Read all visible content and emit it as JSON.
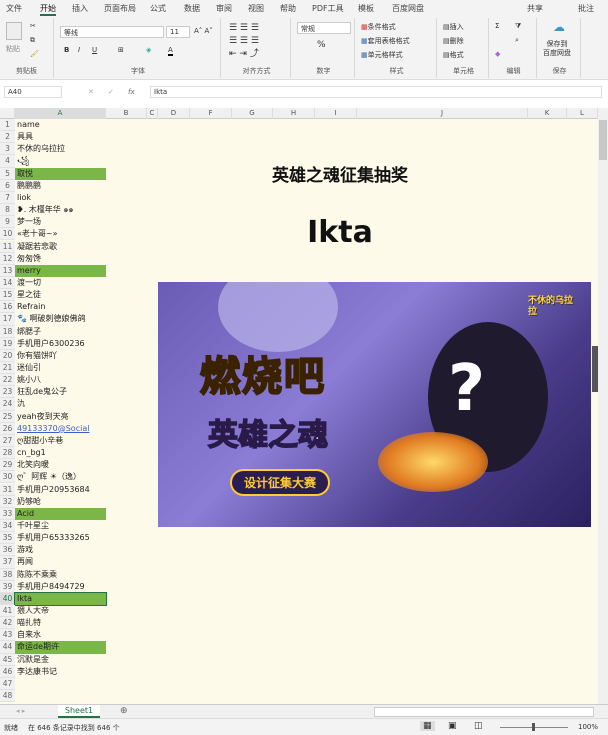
{
  "tabs": [
    "文件",
    "开始",
    "插入",
    "页面布局",
    "公式",
    "数据",
    "审阅",
    "视图",
    "帮助",
    "PDF工具",
    "模板",
    "百度网盘"
  ],
  "active_tab": "开始",
  "share": "共享",
  "comments": "批注",
  "ribbon": {
    "clipboard": {
      "paste": "粘贴",
      "label": "剪贴板"
    },
    "font": {
      "name": "等线",
      "size": "11",
      "label": "字体",
      "bold": "B",
      "italic": "I",
      "underline": "U"
    },
    "align": {
      "label": "对齐方式"
    },
    "number": {
      "format": "常规",
      "percent": "%",
      "label": "数字"
    },
    "styles": {
      "cond": "条件格式",
      "table": "套用表格格式",
      "cell": "单元格样式",
      "label": "样式"
    },
    "cells": {
      "insert": "插入",
      "delete": "删除",
      "format": "格式",
      "label": "单元格"
    },
    "edit": {
      "label": "编辑",
      "sum": "Σ"
    },
    "save": {
      "btn": "保存到\n百度网盘",
      "label": "保存"
    }
  },
  "formula_bar": {
    "name_box": "A40",
    "fx": "fx",
    "value": "Ikta"
  },
  "columns": [
    "A",
    "B",
    "C",
    "D",
    "F",
    "G",
    "H",
    "I",
    "J",
    "K",
    "L"
  ],
  "rows": [
    {
      "n": 1,
      "v": "name"
    },
    {
      "n": 2,
      "v": "具具"
    },
    {
      "n": 3,
      "v": "不休的乌拉拉"
    },
    {
      "n": 4,
      "v": "꧁"
    },
    {
      "n": 5,
      "v": "取悦",
      "hl": true
    },
    {
      "n": 6,
      "v": "鹏鹏鹏"
    },
    {
      "n": 7,
      "v": "liok"
    },
    {
      "n": 8,
      "v": "❥. 木槿年华 ๑๑"
    },
    {
      "n": 9,
      "v": "梦一场"
    },
    {
      "n": 10,
      "v": "«老十哥~»"
    },
    {
      "n": 11,
      "v": "凝踞若悲歌"
    },
    {
      "n": 12,
      "v": "匆匆馋"
    },
    {
      "n": 13,
      "v": "merry",
      "hl": true
    },
    {
      "n": 14,
      "v": "渡一切"
    },
    {
      "n": 15,
      "v": "星之徒"
    },
    {
      "n": 16,
      "v": "Refrain"
    },
    {
      "n": 17,
      "v": "🐾 啊破刺德娘佛鸽"
    },
    {
      "n": 18,
      "v": "绑腮子"
    },
    {
      "n": 19,
      "v": "手机用户6300236"
    },
    {
      "n": 20,
      "v": "你有猫饼吖"
    },
    {
      "n": 21,
      "v": "迷仙引"
    },
    {
      "n": 22,
      "v": "姚小八"
    },
    {
      "n": 23,
      "v": "狂乱de鬼公子"
    },
    {
      "n": 24,
      "v": "氿"
    },
    {
      "n": 25,
      "v": "yeah夜到天亮"
    },
    {
      "n": 26,
      "v": "49133370@Social",
      "link": true
    },
    {
      "n": 27,
      "v": "ღ甜甜小辛巷"
    },
    {
      "n": 28,
      "v": "cn_bg1"
    },
    {
      "n": 29,
      "v": "北笑向暖"
    },
    {
      "n": 30,
      "v": "ღ゛阿辉 ☀（逸）"
    },
    {
      "n": 31,
      "v": "手机用户20953684"
    },
    {
      "n": 32,
      "v": "奶够呛"
    },
    {
      "n": 33,
      "v": "Acid",
      "hl": true
    },
    {
      "n": 34,
      "v": "千叶星尘"
    },
    {
      "n": 35,
      "v": "手机用户65333265"
    },
    {
      "n": 36,
      "v": "游戏"
    },
    {
      "n": 37,
      "v": "再闻"
    },
    {
      "n": 38,
      "v": "陈陈不乘乘"
    },
    {
      "n": 39,
      "v": "手机用户8494729"
    },
    {
      "n": 40,
      "v": "Ikta",
      "hl": true,
      "sel": true
    },
    {
      "n": 41,
      "v": "猥人大帝"
    },
    {
      "n": 42,
      "v": "喵扎特"
    },
    {
      "n": 43,
      "v": "自来水"
    },
    {
      "n": 44,
      "v": "命运de期许",
      "hl": true
    },
    {
      "n": 45,
      "v": "沉默是金"
    },
    {
      "n": 46,
      "v": "李达康书记"
    },
    {
      "n": 47,
      "v": ""
    },
    {
      "n": 48,
      "v": ""
    }
  ],
  "content": {
    "title": "英雄之魂征集抽奖",
    "winner": "Ikta"
  },
  "banner": {
    "logo": "不休的乌拉拉",
    "line1": "燃烧吧",
    "line2": "英雄之魂",
    "sub": "设计征集大赛",
    "mark": "?"
  },
  "sheet_tab": "Sheet1",
  "status": {
    "mode": "就绪",
    "records": "在 646 条记录中找到 646 个",
    "zoom": "100%"
  },
  "colors": {
    "highlight": "#7ab648",
    "sheet_bg": "#fdfaea",
    "accent": "#217346"
  }
}
